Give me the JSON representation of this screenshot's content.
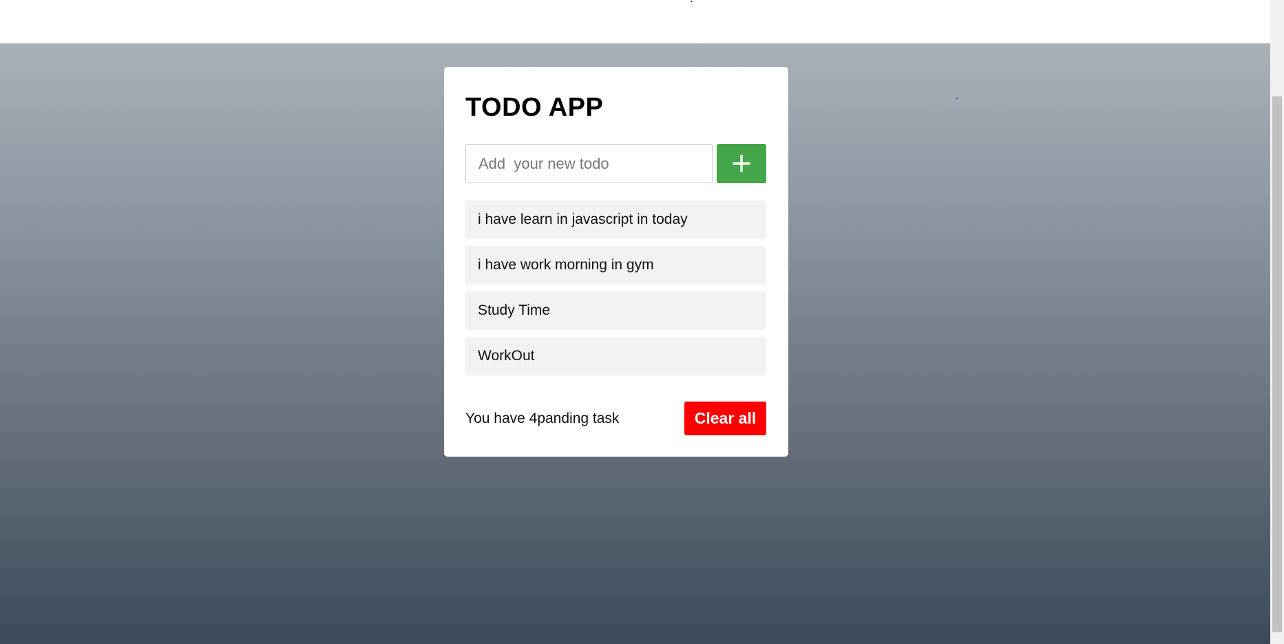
{
  "app": {
    "title": "TODO APP"
  },
  "input": {
    "placeholder": "Add  your new todo",
    "value": ""
  },
  "add_button": {
    "label": "+",
    "color": "#44a648"
  },
  "todos": [
    {
      "text": "i have learn in javascript in today"
    },
    {
      "text": "i have work morning in gym"
    },
    {
      "text": "Study Time"
    },
    {
      "text": "WorkOut"
    }
  ],
  "footer": {
    "pending_text": "You have 4panding task",
    "clear_label": "Clear all",
    "clear_color": "#ff0000"
  }
}
